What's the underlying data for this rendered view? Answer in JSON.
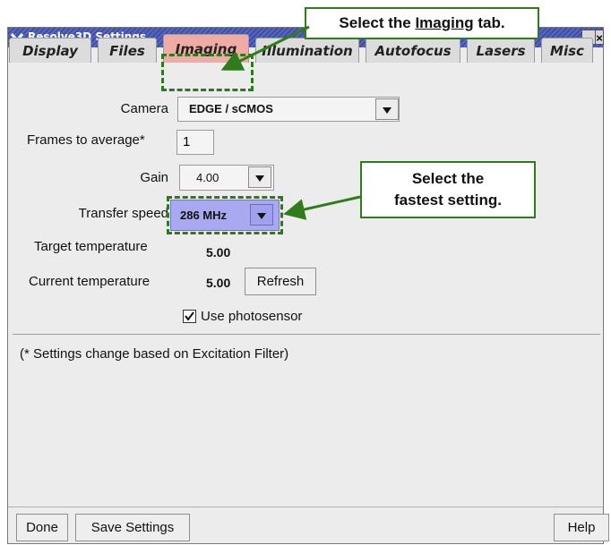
{
  "window": {
    "title": "Resolve3D Settings",
    "minimize": "–",
    "close": "×"
  },
  "tabs": [
    {
      "label": "Display"
    },
    {
      "label": "Files"
    },
    {
      "label": "Imaging"
    },
    {
      "label": "Illumination"
    },
    {
      "label": "Autofocus"
    },
    {
      "label": "Lasers"
    },
    {
      "label": "Misc"
    }
  ],
  "form": {
    "camera_label": "Camera",
    "camera_value": "EDGE / sCMOS",
    "frames_label": "Frames to average*",
    "frames_value": "1",
    "gain_label": "Gain",
    "gain_value": "4.00",
    "transfer_label": "Transfer speed",
    "transfer_value": "286 MHz",
    "target_temp_label": "Target temperature",
    "target_temp_value": "5.00",
    "current_temp_label": "Current temperature",
    "current_temp_value": "5.00",
    "refresh_label": "Refresh",
    "photosensor_label": "Use photosensor",
    "note": "(* Settings change based on Excitation Filter)"
  },
  "footer": {
    "done": "Done",
    "save": "Save Settings",
    "help": "Help"
  },
  "annotations": {
    "callout1_prefix": "Select the ",
    "callout1_link": "Imaging",
    "callout1_suffix": " tab.",
    "callout2_line1": "Select the",
    "callout2_line2": "fastest setting."
  },
  "colors": {
    "active_tab": "#f1aaa5",
    "transfer_highlight": "#a9a9f2",
    "annotation_green": "#2e7d1a",
    "titlebar": "#4a5ab6"
  }
}
